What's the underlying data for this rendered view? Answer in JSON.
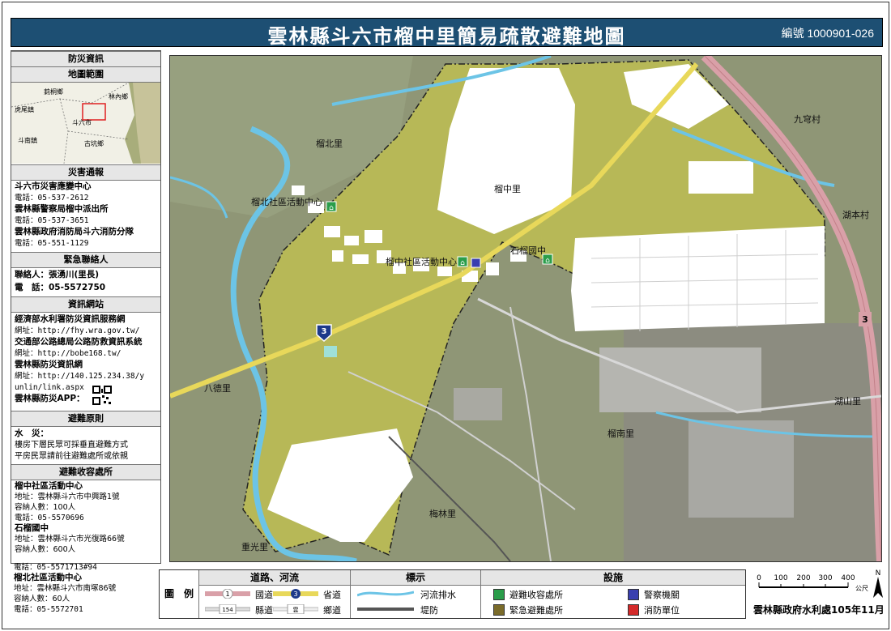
{
  "header": {
    "title": "雲林縣斗六市榴中里簡易疏散避難地圖",
    "serial": "編號 1000901-026"
  },
  "sidebar": {
    "section_info": "防災資訊",
    "section_range": "地圖範圍",
    "inset_labels": [
      "莿桐鄉",
      "林內鄉",
      "虎尾鎮",
      "斗六市",
      "古坑鄉",
      "斗南鎮"
    ],
    "section_report": "災害通報",
    "report_lines": [
      "斗六市災害應變中心",
      "電話：05-537-2612",
      "雲林縣警察局榴中派出所",
      "電話：05-537-3651",
      "雲林縣政府消防局斗六消防分隊",
      "電話：05-551-1129"
    ],
    "section_contact": "緊急聯絡人",
    "contact_lines": [
      "聯絡人：張湧川(里長)",
      "電　話：05-5572750"
    ],
    "section_web": "資訊網站",
    "web_lines": [
      "經濟部水利署防災資訊服務網",
      "網址：http://fhy.wra.gov.tw/",
      "交通部公路總局公路防救資訊系統",
      "網址：http://bobe168.tw/",
      "雲林縣防災資訊網",
      "網址：http://140.125.234.38/y",
      "unlin/link.aspx",
      "雲林縣防災APP："
    ],
    "section_principle": "避難原則",
    "principle_lines": [
      "水　災：",
      "樓房下層民眾可採垂直避難方式",
      "平房民眾請前往避難處所或依親"
    ],
    "section_shelter": "避難收容處所",
    "shelter_lines": [
      "榴中社區活動中心",
      "地址：雲林縣斗六市中興路1號",
      "容納人數：100人",
      "電話：05-5570696",
      "石榴國中",
      "地址：雲林縣斗六市光復路66號",
      "容納人數：600人",
      "電話：05-5571713#94",
      "榴北社區活動中心",
      "地址：雲林縣斗六市南塚86號",
      "容納人數：60人",
      "電話：05-5572701"
    ]
  },
  "map": {
    "labels": {
      "liuzhong": "榴中里",
      "liubei": "榴北里",
      "jiuqiong": "九穹村",
      "hubeng": "湖本村",
      "bade": "八德里",
      "hushan": "湖山里",
      "liunan": "榴南里",
      "meilin": "梅林里",
      "chongguang": "重光里",
      "liubei_center": "榴北社區活動中心",
      "liuzhong_center": "榴中社區活動中心",
      "shiliu_school": "石榴國中"
    },
    "route_shields": [
      "3",
      "3"
    ]
  },
  "legend": {
    "label": "圖　例",
    "col_roads": "道路、河流",
    "col_marks": "標示",
    "col_facilities": "設施",
    "national_road": "國道",
    "provincial_road": "省道",
    "county_road": "縣道",
    "township_road": "鄉道",
    "river": "河流排水",
    "levee": "堤防",
    "shelter": "避難收容處所",
    "emergency_shelter": "緊急避難處所",
    "police": "警察機關",
    "fire": "消防單位",
    "national_num": "1",
    "provincial_num": "3",
    "county_num": "154",
    "township_num": "雲"
  },
  "scale": {
    "ticks": [
      "0",
      "100",
      "200",
      "300",
      "400"
    ],
    "unit": "公尺"
  },
  "footer": {
    "credit": "雲林縣政府水利處105年11月"
  },
  "colors": {
    "title_bg": "#1d4f73",
    "zone": "#b7b857",
    "outside": "#8f9676",
    "river": "#6cc4e6",
    "national_road": "#d9a0a8",
    "provincial_road": "#e8d85a"
  }
}
